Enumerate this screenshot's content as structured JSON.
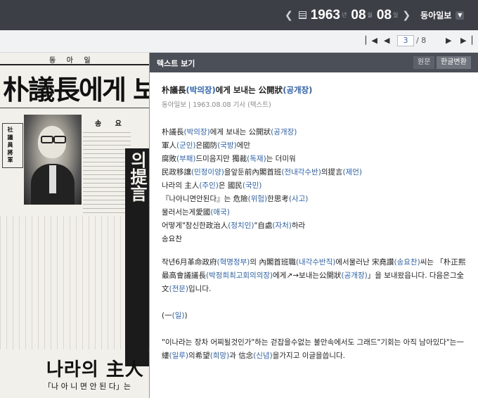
{
  "nav": {
    "year": "1963",
    "year_unit": "년",
    "month": "08",
    "month_unit": "월",
    "day": "08",
    "day_unit": "일",
    "paper": "동아일보"
  },
  "pager": {
    "current": "3",
    "separator": "/",
    "total": "8"
  },
  "scan": {
    "masthead": "동 아 일",
    "headline": "朴議長에게 보",
    "side_box": "社 議 員 將 軍",
    "sub_head": "송 요",
    "vertical_headline": "民政移讓을앞둔前內閣首班의提言",
    "bottom_headline": "나라의 主人",
    "bottom_sub": "「나 아 니 면 안 된 다」는"
  },
  "panel": {
    "title": "텍스트 보기",
    "btn_original": "원문",
    "btn_convert": "한글변환"
  },
  "article": {
    "title_a": "朴議長",
    "title_b": "(박의장)",
    "title_c": "에게 보내는 公開狀",
    "title_d": "(공개장)",
    "meta": "동아일보 | 1963.08.08  기사 (텍스트)",
    "lines": [
      [
        {
          "t": "朴議長"
        },
        {
          "t": "(박의장)",
          "h": true
        },
        {
          "t": "에게 보내는 公開狀"
        },
        {
          "t": "(공개장)",
          "h": true
        }
      ],
      [
        {
          "t": "軍人"
        },
        {
          "t": "(군인)",
          "h": true
        },
        {
          "t": "은國防"
        },
        {
          "t": "(국방)",
          "h": true
        },
        {
          "t": "에만"
        }
      ],
      [
        {
          "t": "腐敗"
        },
        {
          "t": "(부패)",
          "h": true
        },
        {
          "t": "드미음지만 獨裁"
        },
        {
          "t": "(독재)",
          "h": true
        },
        {
          "t": "는 더미워"
        }
      ],
      [
        {
          "t": "民政移讓"
        },
        {
          "t": "(민정이양)",
          "h": true
        },
        {
          "t": "을앞둔前內閣首班"
        },
        {
          "t": "(전내각수반)",
          "h": true
        },
        {
          "t": "의提言"
        },
        {
          "t": "(제언)",
          "h": true
        }
      ],
      [
        {
          "t": "나라의 主人"
        },
        {
          "t": "(주인)",
          "h": true
        },
        {
          "t": "은 國民"
        },
        {
          "t": "(국민)",
          "h": true
        }
      ],
      [
        {
          "t": "『나아니면안된다』는 危險"
        },
        {
          "t": "(위험)",
          "h": true
        },
        {
          "t": "한思考"
        },
        {
          "t": "(사고)",
          "h": true
        }
      ],
      [
        {
          "t": "물러서는게愛國"
        },
        {
          "t": "(애국)",
          "h": true
        }
      ],
      [
        {
          "t": "어떻게\"참신한政治人"
        },
        {
          "t": "(정치인)",
          "h": true
        },
        {
          "t": "\"自處"
        },
        {
          "t": "(자처)",
          "h": true
        },
        {
          "t": "하라"
        }
      ],
      [
        {
          "t": "송요찬"
        }
      ]
    ],
    "para1": [
      {
        "t": " 작년6月革命政府"
      },
      {
        "t": "(혁명정부)",
        "h": true
      },
      {
        "t": "의 內閣首班職"
      },
      {
        "t": "(내각수반직)",
        "h": true
      },
      {
        "t": "에서물러난 宋堯讚"
      },
      {
        "t": "(송요찬)",
        "h": true
      },
      {
        "t": "씨는 「朴正熙最高會議議長"
      },
      {
        "t": "(박정희최고회의의장)",
        "h": true
      },
      {
        "t": "에게↗→보내는公開狀"
      },
      {
        "t": "(공개장)",
        "h": true
      },
      {
        "t": "」을 보내왔읍니다. 다음은그全文"
      },
      {
        "t": "(전문)",
        "h": true
      },
      {
        "t": "입니다."
      }
    ],
    "para2": [
      {
        "t": " ("
      },
      {
        "t": "一",
        "h": false
      },
      {
        "t": "(일)",
        "h": true
      },
      {
        "t": ")"
      }
    ],
    "para3": [
      {
        "t": " \"이나라는 장차 어찌될것인가\"하는 걷잡을수없는 불안속에서도 그래드\"기회는 아직 남아있다\"는一縷"
      },
      {
        "t": "(일루)",
        "h": true
      },
      {
        "t": "의希望"
      },
      {
        "t": "(희망)",
        "h": true
      },
      {
        "t": "과 信念"
      },
      {
        "t": "(신념)",
        "h": true
      },
      {
        "t": "을가지고 이글을씁니다."
      }
    ]
  },
  "colors": {
    "topbar": "#3c3f46",
    "panel_header": "#4b4f57",
    "link": "#2b62b5"
  },
  "icons": [
    "chevron-left-icon",
    "calendar-icon",
    "chevron-right-icon",
    "dropdown-icon",
    "first-page-icon",
    "prev-page-icon",
    "next-page-icon",
    "last-page-icon"
  ]
}
